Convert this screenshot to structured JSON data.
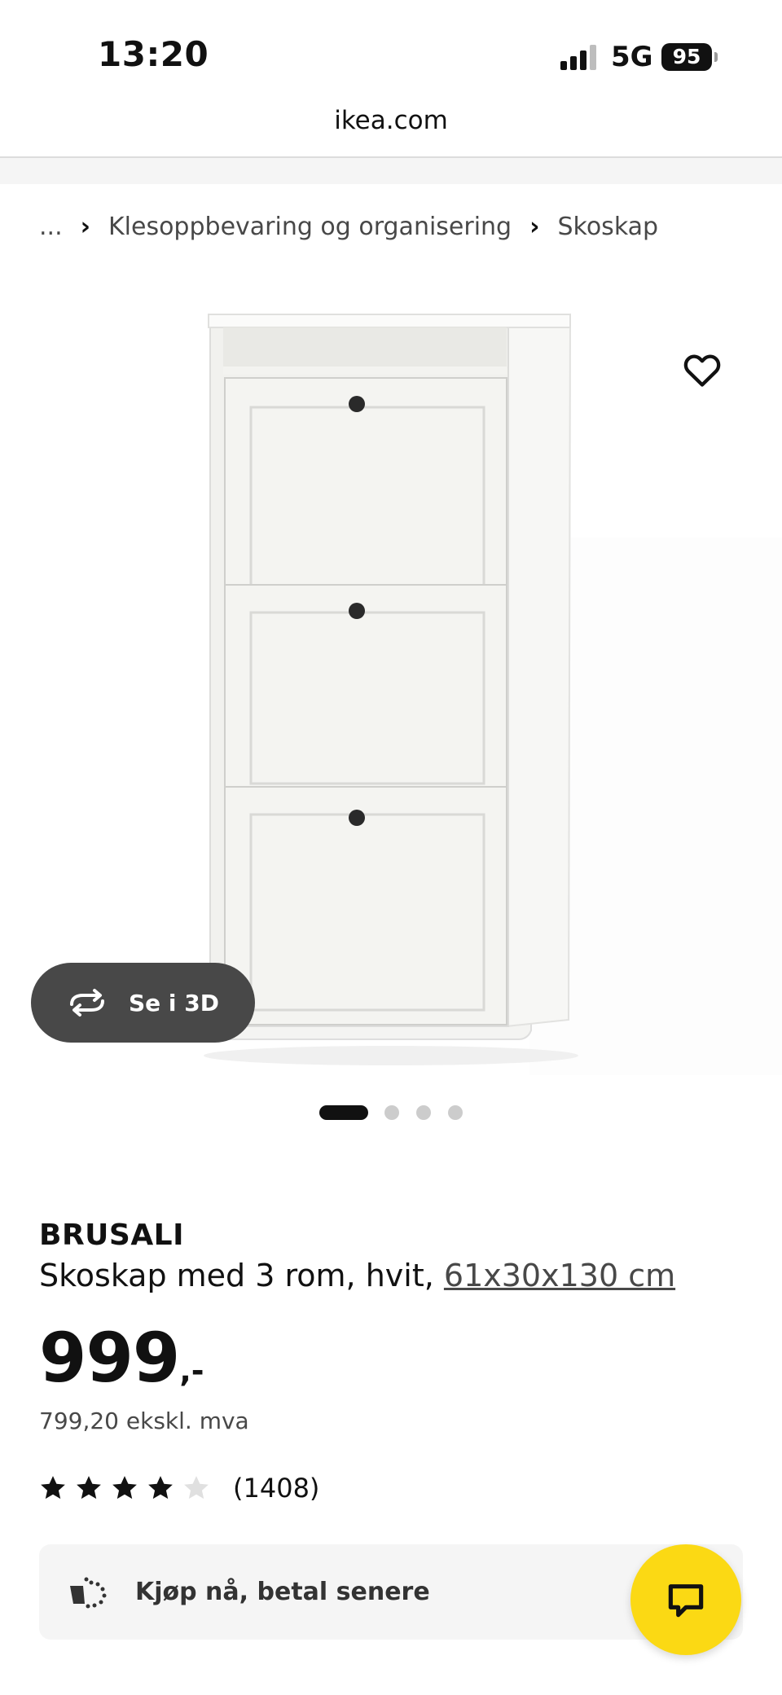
{
  "status_bar": {
    "time": "13:20",
    "network": "5G",
    "battery": "95"
  },
  "browser": {
    "url": "ikea.com"
  },
  "breadcrumb": {
    "ellipsis": "...",
    "items": [
      "Klesoppbevaring og organisering",
      "Skoskap"
    ]
  },
  "gallery": {
    "view_3d_label": "Se i 3D",
    "image_count": 4,
    "active_index": 0,
    "favorite_icon": "heart-icon"
  },
  "product": {
    "name": "BRUSALI",
    "description": "Skoskap med 3 rom, hvit, ",
    "dimensions": "61x30x130 cm",
    "price": "999",
    "price_suffix": ",-",
    "price_excl_vat": "799,20 ekskl. mva",
    "rating": 4.5,
    "rating_max": 5,
    "review_count": "(1408)"
  },
  "bnpl": {
    "label": "Kjøp nå, betal senere",
    "icon": "payment-icon"
  },
  "chat": {
    "icon": "chat-icon"
  },
  "colors": {
    "accent": "#fbd914",
    "dark_button": "#484848",
    "panel": "#f5f5f5"
  }
}
